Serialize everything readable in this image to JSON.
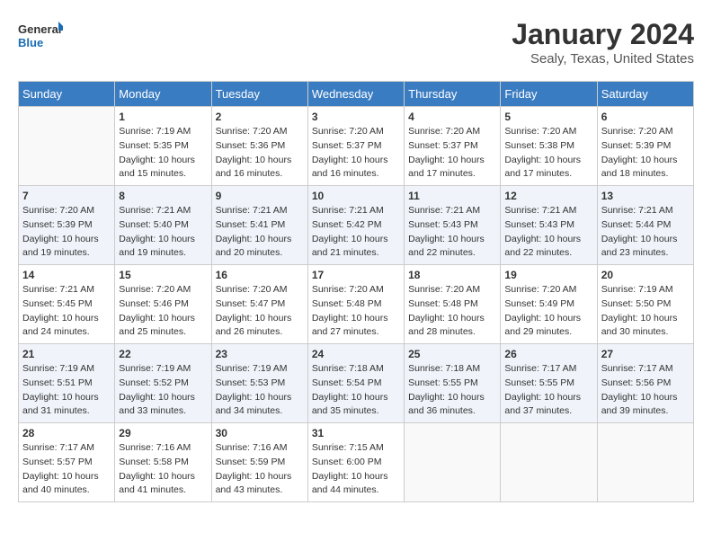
{
  "logo": {
    "line1": "General",
    "line2": "Blue"
  },
  "title": "January 2024",
  "subtitle": "Sealy, Texas, United States",
  "days_of_week": [
    "Sunday",
    "Monday",
    "Tuesday",
    "Wednesday",
    "Thursday",
    "Friday",
    "Saturday"
  ],
  "weeks": [
    [
      {
        "day": "",
        "info": ""
      },
      {
        "day": "1",
        "info": "Sunrise: 7:19 AM\nSunset: 5:35 PM\nDaylight: 10 hours\nand 15 minutes."
      },
      {
        "day": "2",
        "info": "Sunrise: 7:20 AM\nSunset: 5:36 PM\nDaylight: 10 hours\nand 16 minutes."
      },
      {
        "day": "3",
        "info": "Sunrise: 7:20 AM\nSunset: 5:37 PM\nDaylight: 10 hours\nand 16 minutes."
      },
      {
        "day": "4",
        "info": "Sunrise: 7:20 AM\nSunset: 5:37 PM\nDaylight: 10 hours\nand 17 minutes."
      },
      {
        "day": "5",
        "info": "Sunrise: 7:20 AM\nSunset: 5:38 PM\nDaylight: 10 hours\nand 17 minutes."
      },
      {
        "day": "6",
        "info": "Sunrise: 7:20 AM\nSunset: 5:39 PM\nDaylight: 10 hours\nand 18 minutes."
      }
    ],
    [
      {
        "day": "7",
        "info": "Sunrise: 7:20 AM\nSunset: 5:39 PM\nDaylight: 10 hours\nand 19 minutes."
      },
      {
        "day": "8",
        "info": "Sunrise: 7:21 AM\nSunset: 5:40 PM\nDaylight: 10 hours\nand 19 minutes."
      },
      {
        "day": "9",
        "info": "Sunrise: 7:21 AM\nSunset: 5:41 PM\nDaylight: 10 hours\nand 20 minutes."
      },
      {
        "day": "10",
        "info": "Sunrise: 7:21 AM\nSunset: 5:42 PM\nDaylight: 10 hours\nand 21 minutes."
      },
      {
        "day": "11",
        "info": "Sunrise: 7:21 AM\nSunset: 5:43 PM\nDaylight: 10 hours\nand 22 minutes."
      },
      {
        "day": "12",
        "info": "Sunrise: 7:21 AM\nSunset: 5:43 PM\nDaylight: 10 hours\nand 22 minutes."
      },
      {
        "day": "13",
        "info": "Sunrise: 7:21 AM\nSunset: 5:44 PM\nDaylight: 10 hours\nand 23 minutes."
      }
    ],
    [
      {
        "day": "14",
        "info": "Sunrise: 7:21 AM\nSunset: 5:45 PM\nDaylight: 10 hours\nand 24 minutes."
      },
      {
        "day": "15",
        "info": "Sunrise: 7:20 AM\nSunset: 5:46 PM\nDaylight: 10 hours\nand 25 minutes."
      },
      {
        "day": "16",
        "info": "Sunrise: 7:20 AM\nSunset: 5:47 PM\nDaylight: 10 hours\nand 26 minutes."
      },
      {
        "day": "17",
        "info": "Sunrise: 7:20 AM\nSunset: 5:48 PM\nDaylight: 10 hours\nand 27 minutes."
      },
      {
        "day": "18",
        "info": "Sunrise: 7:20 AM\nSunset: 5:48 PM\nDaylight: 10 hours\nand 28 minutes."
      },
      {
        "day": "19",
        "info": "Sunrise: 7:20 AM\nSunset: 5:49 PM\nDaylight: 10 hours\nand 29 minutes."
      },
      {
        "day": "20",
        "info": "Sunrise: 7:19 AM\nSunset: 5:50 PM\nDaylight: 10 hours\nand 30 minutes."
      }
    ],
    [
      {
        "day": "21",
        "info": "Sunrise: 7:19 AM\nSunset: 5:51 PM\nDaylight: 10 hours\nand 31 minutes."
      },
      {
        "day": "22",
        "info": "Sunrise: 7:19 AM\nSunset: 5:52 PM\nDaylight: 10 hours\nand 33 minutes."
      },
      {
        "day": "23",
        "info": "Sunrise: 7:19 AM\nSunset: 5:53 PM\nDaylight: 10 hours\nand 34 minutes."
      },
      {
        "day": "24",
        "info": "Sunrise: 7:18 AM\nSunset: 5:54 PM\nDaylight: 10 hours\nand 35 minutes."
      },
      {
        "day": "25",
        "info": "Sunrise: 7:18 AM\nSunset: 5:55 PM\nDaylight: 10 hours\nand 36 minutes."
      },
      {
        "day": "26",
        "info": "Sunrise: 7:17 AM\nSunset: 5:55 PM\nDaylight: 10 hours\nand 37 minutes."
      },
      {
        "day": "27",
        "info": "Sunrise: 7:17 AM\nSunset: 5:56 PM\nDaylight: 10 hours\nand 39 minutes."
      }
    ],
    [
      {
        "day": "28",
        "info": "Sunrise: 7:17 AM\nSunset: 5:57 PM\nDaylight: 10 hours\nand 40 minutes."
      },
      {
        "day": "29",
        "info": "Sunrise: 7:16 AM\nSunset: 5:58 PM\nDaylight: 10 hours\nand 41 minutes."
      },
      {
        "day": "30",
        "info": "Sunrise: 7:16 AM\nSunset: 5:59 PM\nDaylight: 10 hours\nand 43 minutes."
      },
      {
        "day": "31",
        "info": "Sunrise: 7:15 AM\nSunset: 6:00 PM\nDaylight: 10 hours\nand 44 minutes."
      },
      {
        "day": "",
        "info": ""
      },
      {
        "day": "",
        "info": ""
      },
      {
        "day": "",
        "info": ""
      }
    ]
  ]
}
